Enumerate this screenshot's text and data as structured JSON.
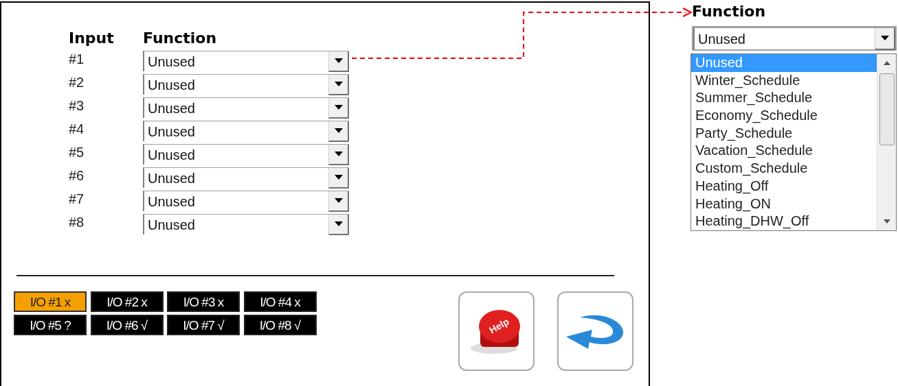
{
  "inputs_panel": {
    "headers": {
      "input": "Input",
      "function": "Function"
    },
    "rows": [
      {
        "number": "#1",
        "value": "Unused"
      },
      {
        "number": "#2",
        "value": "Unused"
      },
      {
        "number": "#3",
        "value": "Unused"
      },
      {
        "number": "#4",
        "value": "Unused"
      },
      {
        "number": "#5",
        "value": "Unused"
      },
      {
        "number": "#6",
        "value": "Unused"
      },
      {
        "number": "#7",
        "value": "Unused"
      },
      {
        "number": "#8",
        "value": "Unused"
      }
    ],
    "io_tabs": [
      {
        "label": "I/O #1 x",
        "selected": true
      },
      {
        "label": "I/O #2 x",
        "selected": false
      },
      {
        "label": "I/O #3 x",
        "selected": false
      },
      {
        "label": "I/O #4 x",
        "selected": false
      },
      {
        "label": "I/O #5 ?",
        "selected": false
      },
      {
        "label": "I/O #6 √",
        "selected": false
      },
      {
        "label": "I/O #7 √",
        "selected": false
      },
      {
        "label": "I/O #8 √",
        "selected": false
      }
    ],
    "help_button": {
      "label": "Help"
    }
  },
  "callout": {
    "label": "Function",
    "value": "Unused",
    "options": [
      {
        "label": "Unused",
        "selected": true
      },
      {
        "label": "Winter_Schedule",
        "selected": false
      },
      {
        "label": "Summer_Schedule",
        "selected": false
      },
      {
        "label": "Economy_Schedule",
        "selected": false
      },
      {
        "label": "Party_Schedule",
        "selected": false
      },
      {
        "label": "Vacation_Schedule",
        "selected": false
      },
      {
        "label": "Custom_Schedule",
        "selected": false
      },
      {
        "label": "Heating_Off",
        "selected": false
      },
      {
        "label": "Heating_ON",
        "selected": false
      },
      {
        "label": "Heating_DHW_Off",
        "selected": false
      }
    ]
  }
}
